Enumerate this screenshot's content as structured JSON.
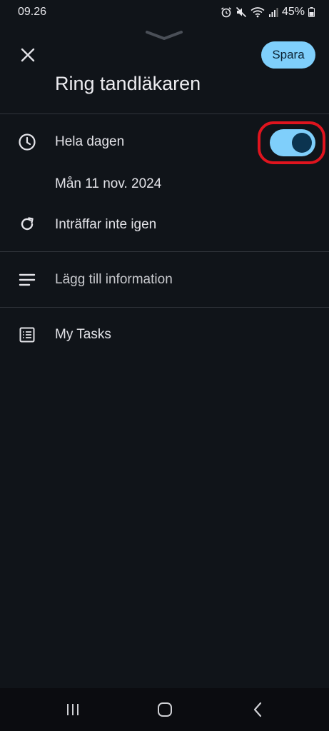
{
  "status_bar": {
    "time": "09.26",
    "battery_percent": "45%",
    "icons": [
      "alarm-icon",
      "mute-icon",
      "wifi-icon",
      "signal-icon",
      "battery-icon"
    ]
  },
  "header": {
    "save_label": "Spara",
    "title": "Ring tandläkaren"
  },
  "rows": {
    "all_day": {
      "label": "Hela dagen",
      "icon": "clock-icon",
      "toggle_on": true
    },
    "date": {
      "label": "Mån 11 nov. 2024"
    },
    "repeat": {
      "label": "Inträffar inte igen",
      "icon": "repeat-icon"
    },
    "details": {
      "label": "Lägg till information",
      "icon": "notes-icon"
    },
    "list": {
      "label": "My Tasks",
      "icon": "list-icon"
    }
  },
  "colors": {
    "background": "#101419",
    "accent": "#7fcffb",
    "highlight": "#e0141e"
  }
}
